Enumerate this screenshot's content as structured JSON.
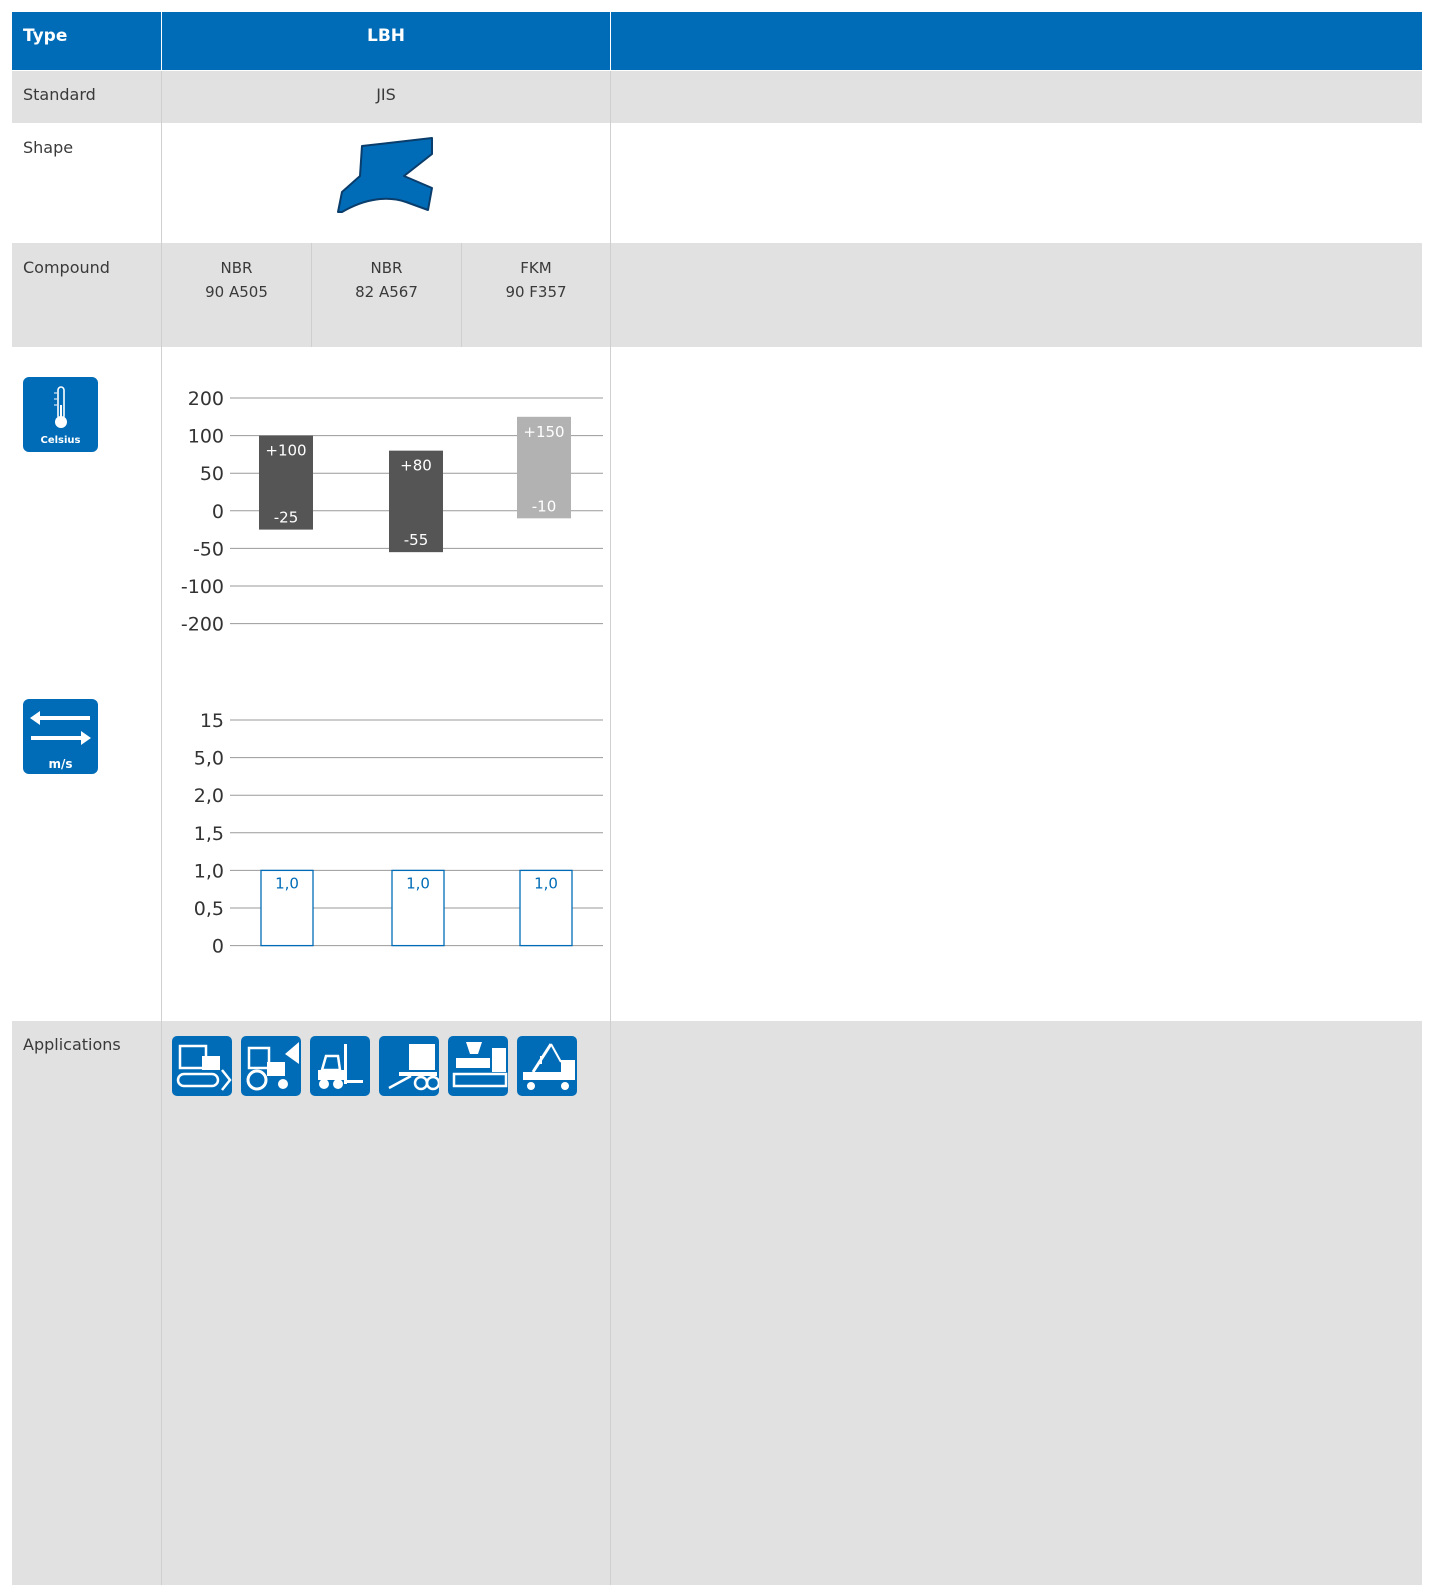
{
  "header": {
    "type_label": "Type",
    "type_value": "LBH"
  },
  "rows": {
    "standard": {
      "label": "Standard",
      "value": "JIS"
    },
    "shape": {
      "label": "Shape"
    },
    "compound": {
      "label": "Compound",
      "items": [
        {
          "name": "NBR",
          "code": "90 A505"
        },
        {
          "name": "NBR",
          "code": "82 A567"
        },
        {
          "name": "FKM",
          "code": "90 F357"
        }
      ]
    },
    "applications": {
      "label": "Applications",
      "icons": [
        "bulldozer-icon",
        "tractor-icon",
        "forklift-icon",
        "trailer-icon",
        "injection-molding-machine-icon",
        "truck-crane-icon"
      ]
    }
  },
  "icons": {
    "temperature": {
      "name": "thermometer-icon",
      "caption": "Celsius"
    },
    "speed": {
      "name": "speed-arrows-icon",
      "caption": "m/s"
    }
  },
  "colors": {
    "brand_blue": "#006cb7",
    "dark_bar": "#555555",
    "light_bar": "#b2b2b2",
    "row_gray": "#e1e1e1"
  },
  "chart_data": [
    {
      "type": "bar",
      "subtype": "range",
      "categories": [
        "NBR 90 A505",
        "NBR 82 A567",
        "FKM 90 F357"
      ],
      "y_ticks": [
        "200",
        "100",
        "50",
        "0",
        "-50",
        "-100",
        "-200"
      ],
      "series": [
        {
          "min": -25,
          "max": 100,
          "min_label": "-25",
          "max_label": "+100",
          "color": "#555555"
        },
        {
          "min": -55,
          "max": 80,
          "min_label": "-55",
          "max_label": "+80",
          "color": "#555555"
        },
        {
          "min": -10,
          "max": 150,
          "min_label": "-10",
          "max_label": "+150",
          "color": "#b2b2b2"
        }
      ],
      "grid": true
    },
    {
      "type": "bar",
      "categories": [
        "NBR 90 A505",
        "NBR 82 A567",
        "FKM 90 F357"
      ],
      "y_ticks": [
        "15",
        "5,0",
        "2,0",
        "1,5",
        "1,0",
        "0,5",
        "0"
      ],
      "values": [
        1.0,
        1.0,
        1.0
      ],
      "value_labels": [
        "1,0",
        "1,0",
        "1,0"
      ],
      "grid": true
    }
  ]
}
